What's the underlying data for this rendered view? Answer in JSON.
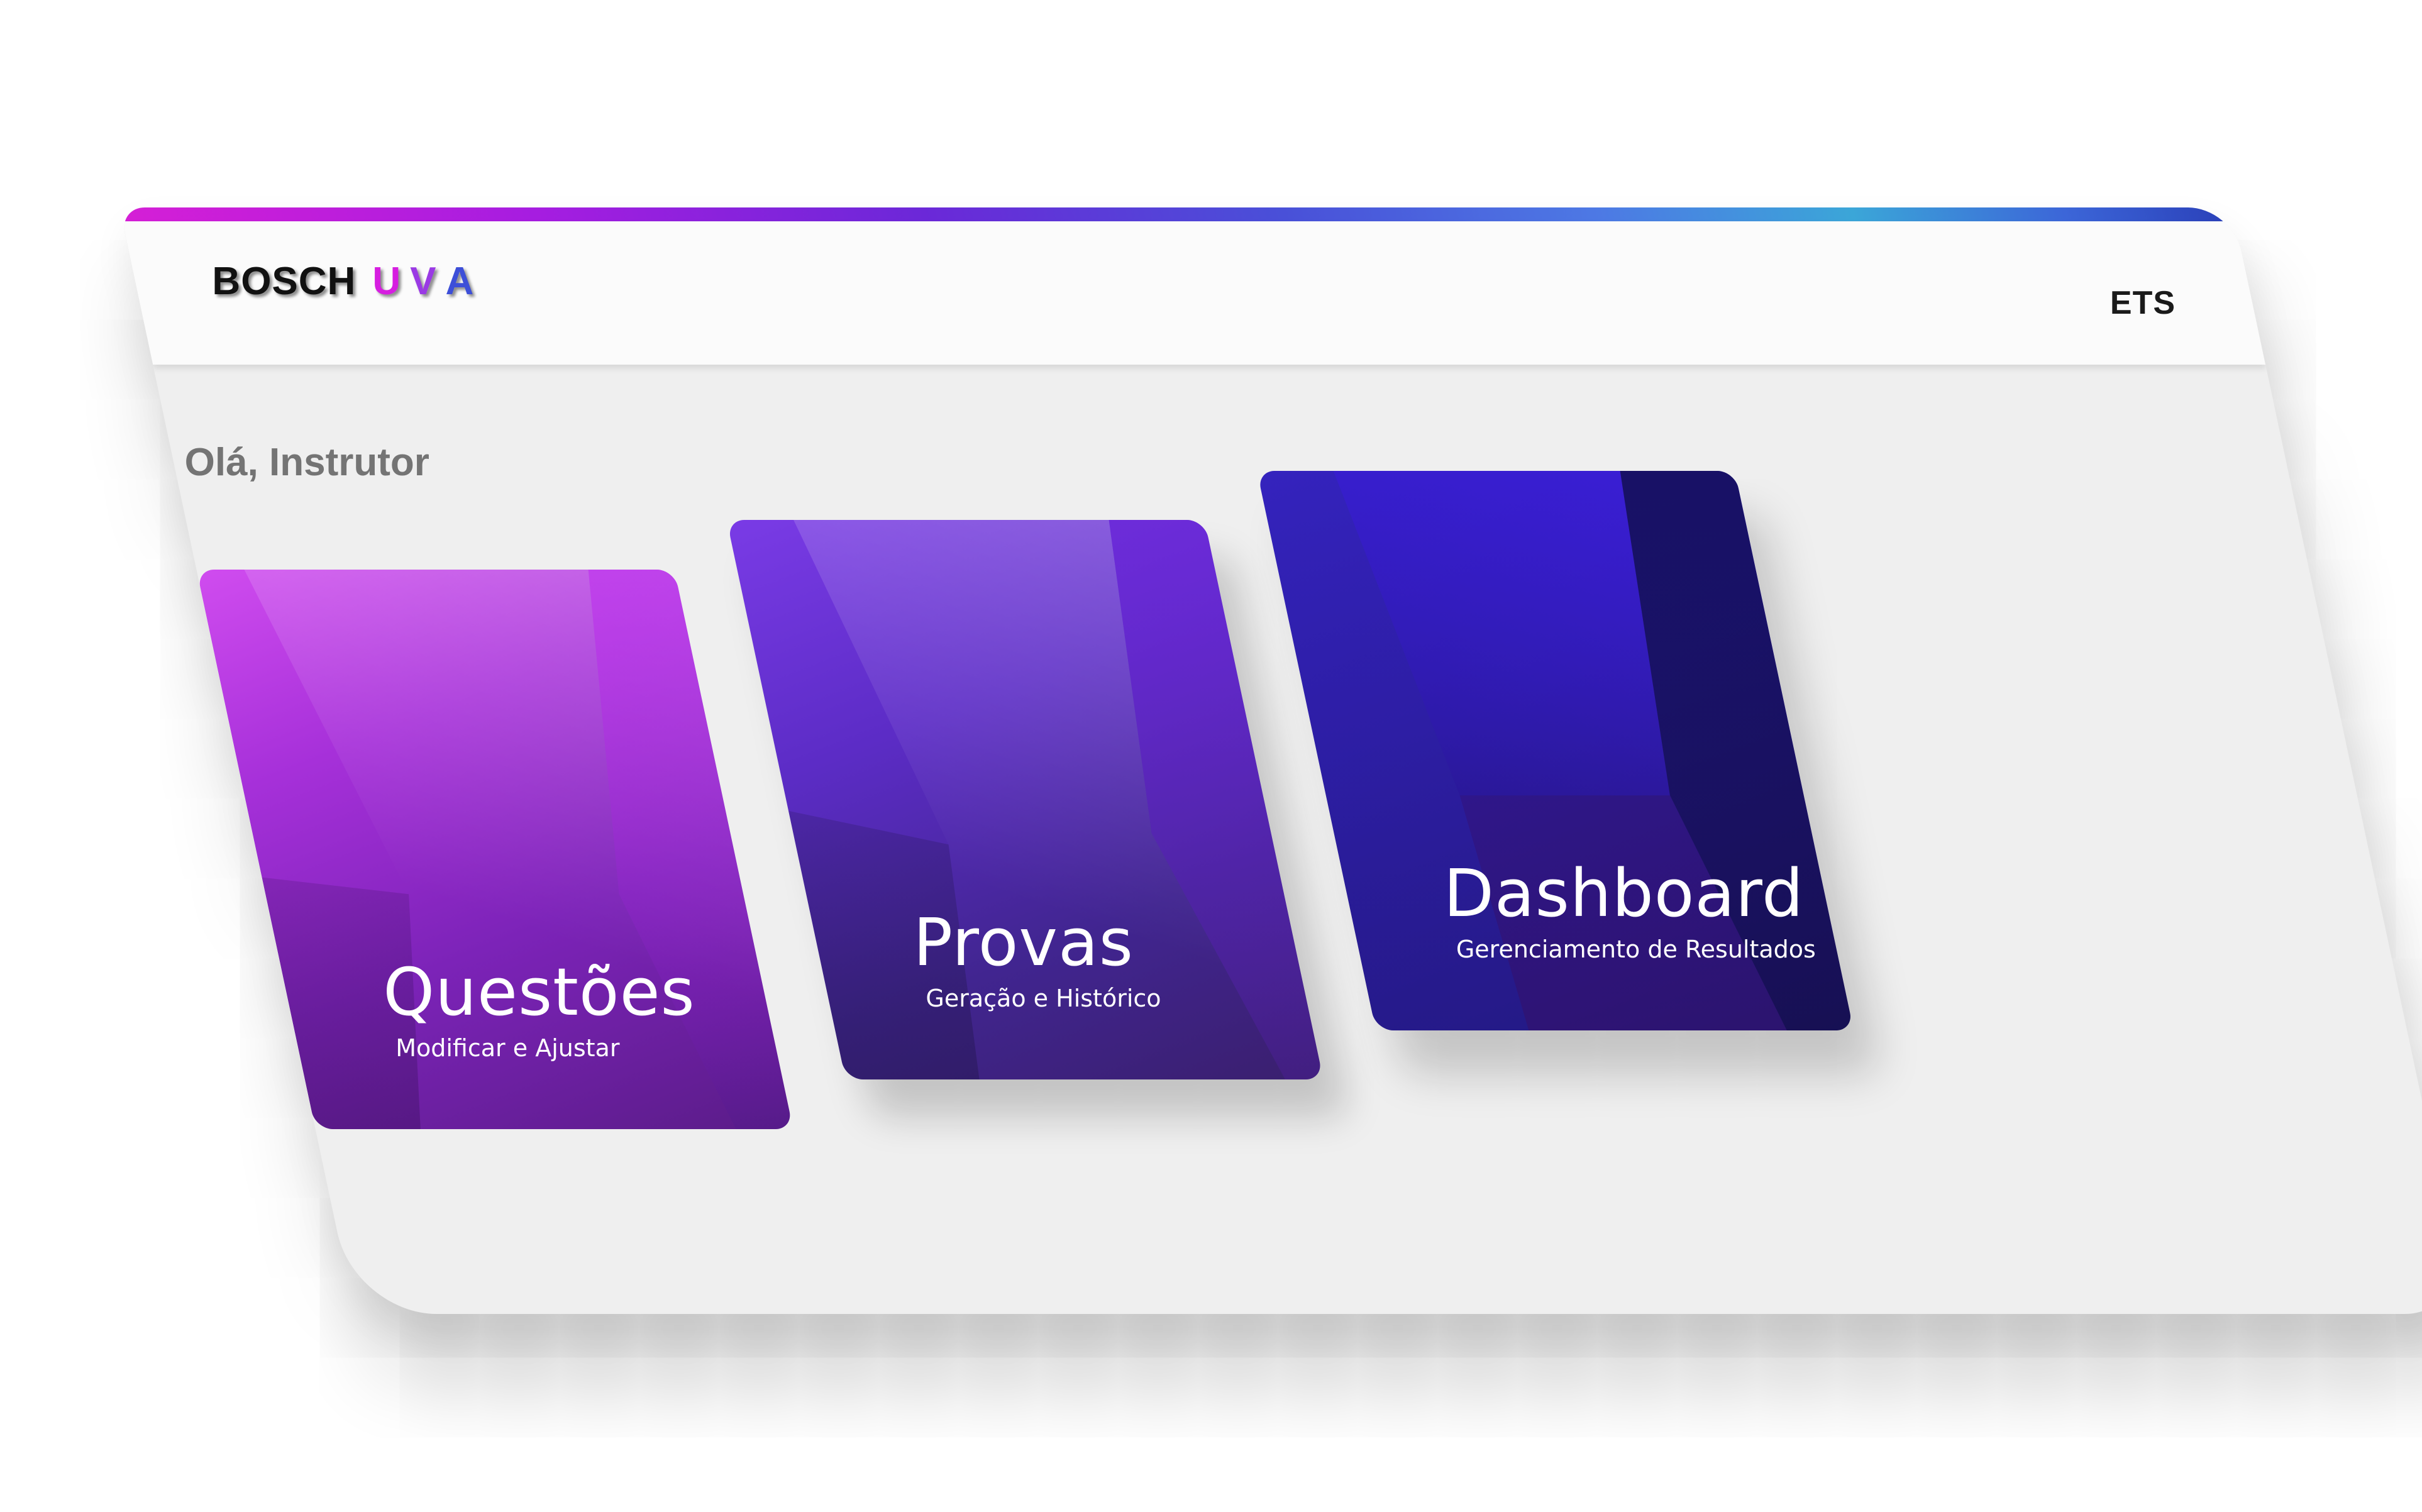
{
  "header": {
    "logo": {
      "brand": "BOSCH",
      "u": "U",
      "v": "V",
      "a": "A"
    },
    "org_label": "ETS"
  },
  "greeting": "Olá, Instrutor",
  "cards": [
    {
      "title": "Questões",
      "subtitle": "Modificar e Ajustar"
    },
    {
      "title": "Provas",
      "subtitle": "Geração e Histórico"
    },
    {
      "title": "Dashboard",
      "subtitle": "Gerenciamento de Resultados"
    }
  ],
  "colors": {
    "background": "#efefef",
    "header": "#fbfbfb",
    "accent_magenta": "#d51fd6",
    "accent_purple": "#6b28d8",
    "accent_blue": "#3c66d8",
    "greeting_text": "#747474"
  }
}
